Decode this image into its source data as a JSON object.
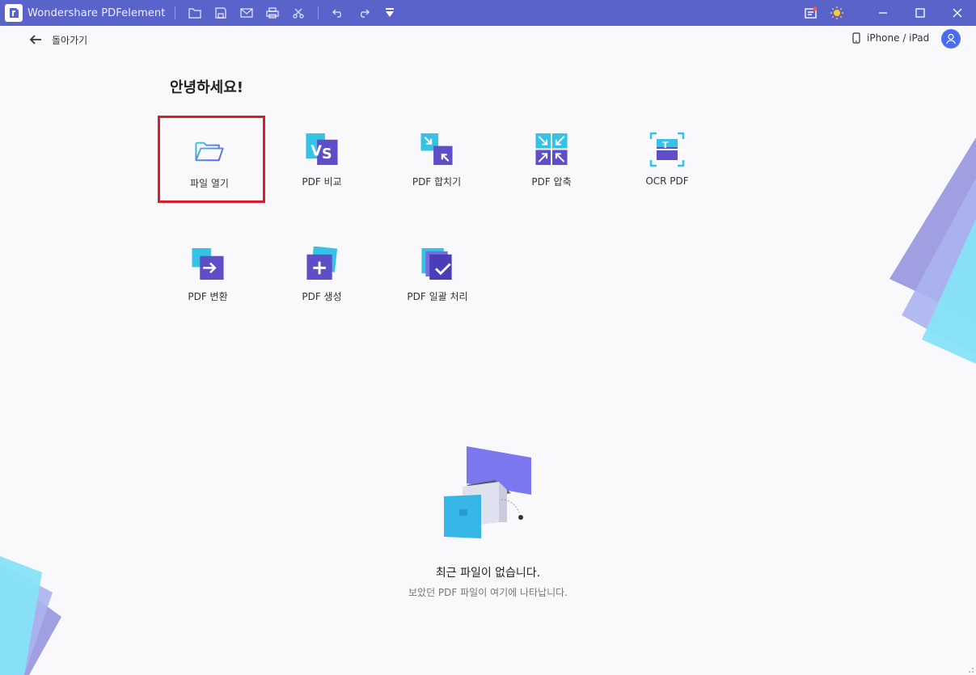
{
  "app": {
    "title": "Wondershare PDFelement",
    "accent_color": "#5a63c9"
  },
  "toolbar": {
    "icons": [
      "folder-icon",
      "save-icon",
      "mail-icon",
      "print-icon",
      "scissors-icon",
      "undo-icon",
      "redo-icon",
      "dropdown-icon"
    ],
    "right_icons": [
      "notification-icon",
      "theme-sun-icon"
    ],
    "window_controls": [
      "minimize-icon",
      "maximize-icon",
      "close-icon"
    ]
  },
  "nav": {
    "back_label": "돌아가기",
    "device_label": "iPhone / iPad"
  },
  "main": {
    "greeting": "안녕하세요!",
    "tools": [
      {
        "label": "파일 열기",
        "icon": "folder-open-icon"
      },
      {
        "label": "PDF 비교",
        "icon": "compare-vs-icon"
      },
      {
        "label": "PDF 합치기",
        "icon": "merge-icon"
      },
      {
        "label": "PDF 압축",
        "icon": "compress-icon"
      },
      {
        "label": "OCR PDF",
        "icon": "ocr-icon"
      },
      {
        "label": "PDF 변환",
        "icon": "convert-icon"
      },
      {
        "label": "PDF 생성",
        "icon": "create-plus-icon"
      },
      {
        "label": "PDF 일괄 처리",
        "icon": "batch-check-icon"
      }
    ],
    "highlighted_tool": "파일 열기"
  },
  "recent": {
    "empty_title": "최근 파일이 없습니다.",
    "empty_subtitle": "보았던 PDF 파일이 여기에 나타납니다."
  }
}
